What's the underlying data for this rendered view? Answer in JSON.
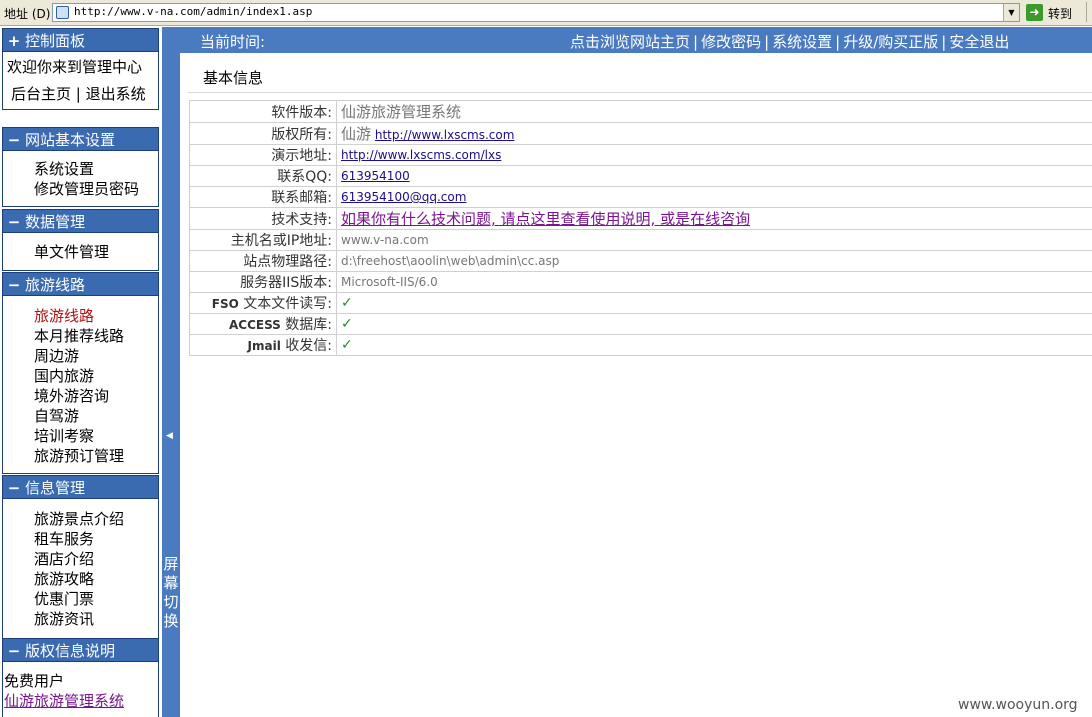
{
  "browser": {
    "address_label": "地址 (D)",
    "url": "http://www.v-na.com/admin/index1.asp",
    "go_label": "转到"
  },
  "sidebar": {
    "control_panel": {
      "title": "控制面板",
      "welcome": "欢迎你来到管理中心",
      "home_link": "后台主页",
      "divider": "|",
      "logout_link": "退出系统"
    },
    "sections": [
      {
        "title": "网站基本设置",
        "items": [
          "系统设置",
          "修改管理员密码"
        ]
      },
      {
        "title": "数据管理",
        "items": [
          "单文件管理"
        ]
      },
      {
        "title": "旅游线路",
        "items": [
          "旅游线路",
          "本月推荐线路",
          "周边游",
          "国内旅游",
          "境外游咨询",
          "自驾游",
          "培训考察",
          "旅游预订管理"
        ]
      },
      {
        "title": "信息管理",
        "items": [
          "旅游景点介绍",
          "租车服务",
          "酒店介绍",
          "旅游攻略",
          "优惠门票",
          "旅游资讯"
        ]
      },
      {
        "title": "版权信息说明",
        "items": [
          "免费用户",
          "仙游旅游管理系统"
        ]
      }
    ]
  },
  "splitter": {
    "label": "屏幕切换"
  },
  "topbar": {
    "time_label": "当前时间:",
    "links": [
      "点击浏览网站主页",
      "修改密码",
      "系统设置",
      "升级/购买正版",
      "安全退出"
    ],
    "separator": "|"
  },
  "content": {
    "title": "基本信息",
    "rows": {
      "version_label": "软件版本:",
      "version_value": "仙游旅游管理系统",
      "copyright_label": "版权所有:",
      "copyright_name": "仙游",
      "copyright_url": "http://www.lxscms.com",
      "demo_label": "演示地址:",
      "demo_url": "http://www.lxscms.com/lxs",
      "qq_label": "联系QQ:",
      "qq_value": "613954100",
      "email_label": "联系邮箱:",
      "email_value": "613954100@qq.com",
      "support_label": "技术支持:",
      "support_value": "如果你有什么技术问题, 请点这里查看使用说明, 或是在线咨询",
      "host_label": "主机名或IP地址:",
      "host_value": "www.v-na.com",
      "path_label": "站点物理路径:",
      "path_value": "d:\\freehost\\aoolin\\web\\admin\\cc.asp",
      "iis_label": "服务器IIS版本:",
      "iis_value": "Microsoft-IIS/6.0",
      "fso_prefix": "FSO",
      "fso_label": " 文本文件读写:",
      "access_prefix": "ACCESS",
      "access_label": " 数据库:",
      "jmail_prefix": "Jmail",
      "jmail_label": " 收发信:",
      "check": "✓"
    }
  },
  "watermark": "www.wooyun.org"
}
